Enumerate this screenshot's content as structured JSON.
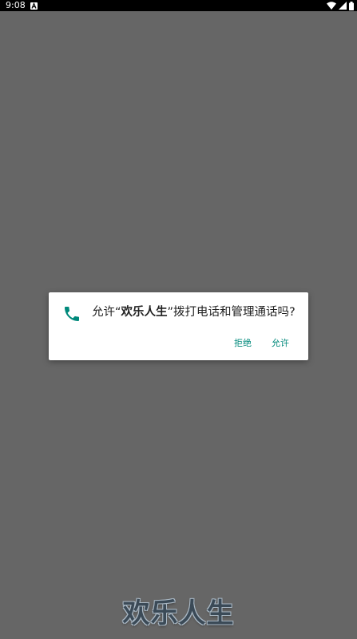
{
  "status_bar": {
    "time": "9:08",
    "icons": [
      "notification-a-icon",
      "wifi-icon",
      "signal-icon",
      "battery-icon"
    ],
    "background": "#000000"
  },
  "dialog": {
    "icon": "phone-icon",
    "icon_color": "#00897b",
    "message_prefix": "允许“",
    "app_name": "欢乐人生",
    "message_suffix": "”拨打电话和管理通话吗?",
    "deny_label": "拒绝",
    "allow_label": "允许",
    "button_color": "#00897b"
  },
  "background_logo": {
    "text": "欢乐人生"
  },
  "colors": {
    "overlay": "#666666",
    "accent": "#00897b"
  }
}
